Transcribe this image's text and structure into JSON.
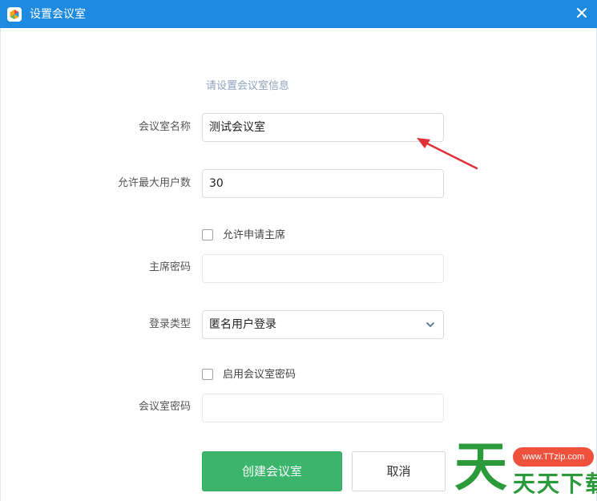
{
  "window": {
    "title": "设置会议室",
    "close_icon": "close-icon",
    "app_icon": "meeting-app-icon"
  },
  "form": {
    "hint": "请设置会议室信息",
    "room_name": {
      "label": "会议室名称",
      "value": "测试会议室"
    },
    "max_users": {
      "label": "允许最大用户数",
      "value": "30"
    },
    "allow_apply_chair": {
      "label": "允许申请主席",
      "checked": false
    },
    "chair_password": {
      "label": "主席密码",
      "value": ""
    },
    "login_type": {
      "label": "登录类型",
      "value": "匿名用户登录"
    },
    "enable_room_password": {
      "label": "启用会议室密码",
      "checked": false
    },
    "room_password": {
      "label": "会议室密码",
      "value": ""
    }
  },
  "buttons": {
    "create": "创建会议室",
    "cancel": "取消"
  },
  "annotation": {
    "arrow_color": "#e0313a"
  },
  "watermark": {
    "url": "www.TTzip.com",
    "big_char": "天",
    "text": "天天下载"
  },
  "colors": {
    "titlebar": "#1e8be0",
    "primary": "#3ab56b",
    "hint": "#8fa3bd"
  }
}
